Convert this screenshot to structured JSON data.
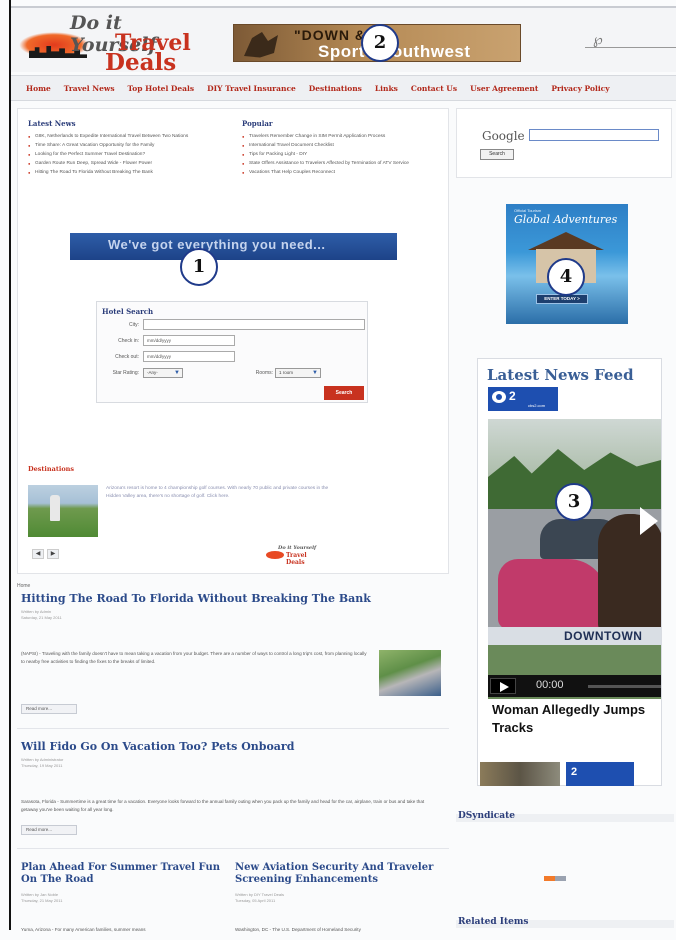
{
  "header": {
    "logo_line1": "Do it Yourself",
    "logo_line2": "Travel",
    "logo_line3": "Deals",
    "banner_line1": "\"DOWN &",
    "banner_line2": "Sports      Southwest"
  },
  "nav": {
    "items": [
      "Home",
      "Travel News",
      "Top Hotel Deals",
      "DIY Travel Insurance",
      "Destinations",
      "Links",
      "Contact Us",
      "User Agreement",
      "Privacy Policy"
    ]
  },
  "latest_news": {
    "heading": "Latest News",
    "items": [
      "G8K, Netherlands to Expedite International Travel Between Two Nations",
      "Time Share: A Great Vacation Opportunity for the Family",
      "Looking for the Perfect Summer Travel Destination?",
      "Garden Route Run Deep, Spread Wide - Flower Power",
      "Hitting The Road To Florida Without Breaking The Bank"
    ]
  },
  "popular": {
    "heading": "Popular",
    "items": [
      "Travelers Remember Change in SIM Permit Application Process",
      "International Travel Document Checklist",
      "Tips for Packing Light - DIY",
      "State Offers Assistance to Travelers Affected by Termination of ATV Service",
      "Vacations That Help Couples Reconnect"
    ]
  },
  "promo_bar": "We've got everything you need...",
  "hotel_search": {
    "title": "Hotel Search",
    "city_label": "City:",
    "checkin_label": "Check in:",
    "checkin_value": "mm/dd/yyyy",
    "checkout_label": "Check out:",
    "checkout_value": "mm/dd/yyyy",
    "rating_label": "Star Rating:",
    "rating_value": "-Any-",
    "rooms_label": "Rooms:",
    "rooms_value": "1 room",
    "button": "Search"
  },
  "destinations": {
    "heading": "Destinations",
    "text": "Arizona's resort is home to 4 championship golf courses. With nearly 70 public and private courses in the Hidden Valley area, there's no shortage of golf. Click here."
  },
  "minilogo": {
    "a": "Do it Yourself",
    "b": "Travel Deals"
  },
  "articles": {
    "breadcrumb": "Home",
    "a1": {
      "title": "Hitting The Road To Florida Without Breaking The Bank",
      "meta1": "Written by Admin",
      "meta2": "Saturday, 21 May 2011",
      "body": "(NAPSI) - Traveling with the family doesn't have to mean taking a vacation from your budget. There are a number of ways to control a long trip's cost, from planning locally to nearby free activities to finding the fixes to the breaks of limited.",
      "read_more": "Read more..."
    },
    "a2": {
      "title": "Will Fido Go On Vacation Too? Pets Onboard",
      "meta1": "Written by Administrator",
      "meta2": "Thursday, 19 May 2011",
      "body": "Sarasota, Florida - Summertime is a great time for a vacation. Everyone looks forward to the annual family outing when you pack up the family and head for the car, airplane, train or bus and take that getaway you've been waiting for all year long.",
      "read_more": "Read more..."
    },
    "a3": {
      "title": "Plan Ahead For Summer Travel Fun On The Road",
      "meta1": "Written by Jan Noble",
      "meta2": "Thursday, 21 May 2011",
      "body": "Yuma, Arizona - For many American families, summer means"
    },
    "a4": {
      "title": "New Aviation Security And Traveler Screening Enhancements",
      "meta1": "Written by DIY Travel Deals",
      "meta2": "Tuesday, 05 April 2011",
      "body": "Washington, DC - The U.S. Department of Homeland Security"
    }
  },
  "sidebar": {
    "google_logo": "Google",
    "google_button": "Search",
    "ad_line1": "Official Tourism",
    "ad_line2": "Global Adventures",
    "ad_cta": "ENTER TODAY >",
    "feed_title": "Latest News Feed",
    "cbs_text": "2",
    "cbs_small": "cbs2.com",
    "video_caption": "DOWNTOWN",
    "video_time": "00:00",
    "headline_line1": "Woman Allegedly Jumps",
    "headline_line2": "Tracks",
    "thumb2_text": "2",
    "syndicate_title": "DSyndicate",
    "related_title": "Related Items"
  },
  "callouts": [
    "1",
    "2",
    "3",
    "4"
  ]
}
